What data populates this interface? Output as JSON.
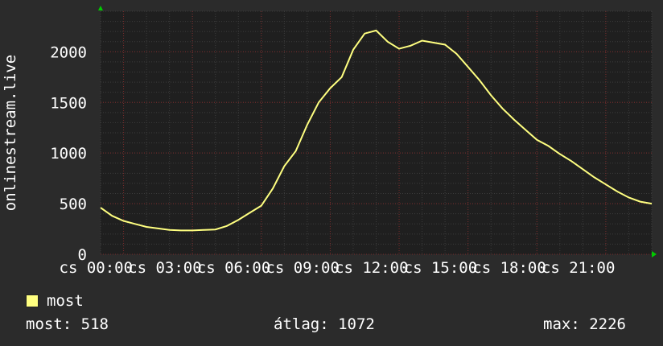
{
  "chart_data": {
    "type": "line",
    "ylabel": "onlinestream.live",
    "ylim": [
      0,
      2400
    ],
    "yticks": [
      "0",
      "500",
      "1000",
      "1500",
      "2000"
    ],
    "ytick_values": [
      0,
      500,
      1000,
      1500,
      2000
    ],
    "xticks": [
      "cs 00:00",
      "cs 03:00",
      "cs 06:00",
      "cs 09:00",
      "cs 12:00",
      "cs 15:00",
      "cs 18:00",
      "cs 21:00"
    ],
    "xtick_hours": [
      0,
      3,
      6,
      9,
      12,
      15,
      18,
      21
    ],
    "xlim_hours": [
      -1,
      23
    ],
    "grid": true,
    "series": [
      {
        "name": "most",
        "color": "#ffff80",
        "x_hours": [
          -1,
          -0.5,
          0,
          0.5,
          1,
          1.5,
          2,
          2.5,
          3,
          3.5,
          4,
          4.5,
          5,
          5.5,
          6,
          6.5,
          7,
          7.5,
          8,
          8.5,
          9,
          9.5,
          10,
          10.5,
          11,
          11.5,
          12,
          12.5,
          13,
          13.5,
          14,
          14.5,
          15,
          15.5,
          16,
          16.5,
          17,
          17.5,
          18,
          18.5,
          19,
          19.5,
          20,
          20.5,
          21,
          21.5,
          22,
          22.5,
          23
        ],
        "values": [
          460,
          380,
          330,
          300,
          270,
          255,
          240,
          235,
          235,
          240,
          245,
          280,
          340,
          410,
          480,
          650,
          870,
          1020,
          1280,
          1500,
          1640,
          1750,
          2020,
          2180,
          2210,
          2100,
          2030,
          2060,
          2110,
          2090,
          2070,
          1980,
          1850,
          1720,
          1570,
          1440,
          1330,
          1230,
          1130,
          1070,
          990,
          920,
          840,
          760,
          690,
          620,
          560,
          520,
          500
        ]
      }
    ]
  },
  "legend": {
    "label": "most",
    "color": "#ffff80"
  },
  "stats": {
    "now": "most: 518",
    "avg": "átlag: 1072",
    "max": "max: 2226"
  }
}
